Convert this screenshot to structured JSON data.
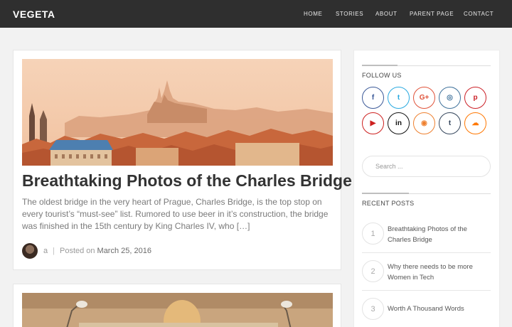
{
  "site": {
    "brand": "VEGETA"
  },
  "nav": {
    "items": [
      "HOME",
      "STORIES",
      "ABOUT",
      "PARENT PAGE",
      "CONTACT"
    ]
  },
  "post": {
    "title": "Breathtaking Photos of the Charles Bridge",
    "excerpt": "The oldest bridge in the very heart of Prague, Charles Bridge, is the top stop on every tourist’s “must-see” list. Rumored to use beer in it’s construction, the bridge was finished in the 15th century by King Charles IV, who […]",
    "author": "a",
    "posted_label": "Posted on",
    "date": "March 25, 2016"
  },
  "sidebar": {
    "follow_title": "FOLLOW US",
    "social": [
      {
        "name": "facebook-icon",
        "glyph": "f",
        "color": "#3b5998"
      },
      {
        "name": "twitter-icon",
        "glyph": "t",
        "color": "#29a9e0"
      },
      {
        "name": "google-plus-icon",
        "glyph": "G+",
        "color": "#e0533a"
      },
      {
        "name": "instagram-icon",
        "glyph": "◎",
        "color": "#3f729b"
      },
      {
        "name": "pinterest-icon",
        "glyph": "p",
        "color": "#cb2027"
      },
      {
        "name": "youtube-icon",
        "glyph": "▶",
        "color": "#cd201f"
      },
      {
        "name": "linkedin-icon",
        "glyph": "in",
        "color": "#111111"
      },
      {
        "name": "rss-icon",
        "glyph": "◉",
        "color": "#ee802f"
      },
      {
        "name": "tumblr-icon",
        "glyph": "t",
        "color": "#35465c"
      },
      {
        "name": "soundcloud-icon",
        "glyph": "☁",
        "color": "#ff7700"
      }
    ],
    "search_placeholder": "Search ...",
    "recent_title": "RECENT POSTS",
    "recent": [
      {
        "num": "1",
        "title": "Breathtaking Photos of the Charles Bridge"
      },
      {
        "num": "2",
        "title": "Why there needs to be more Women in Tech"
      },
      {
        "num": "3",
        "title": "Worth A Thousand Words"
      }
    ]
  },
  "colors": {
    "topbar": "#2f2f2f",
    "page": "#f2f2f2",
    "card": "#ffffff",
    "title": "#333333",
    "excerpt": "#7a7a7a"
  }
}
